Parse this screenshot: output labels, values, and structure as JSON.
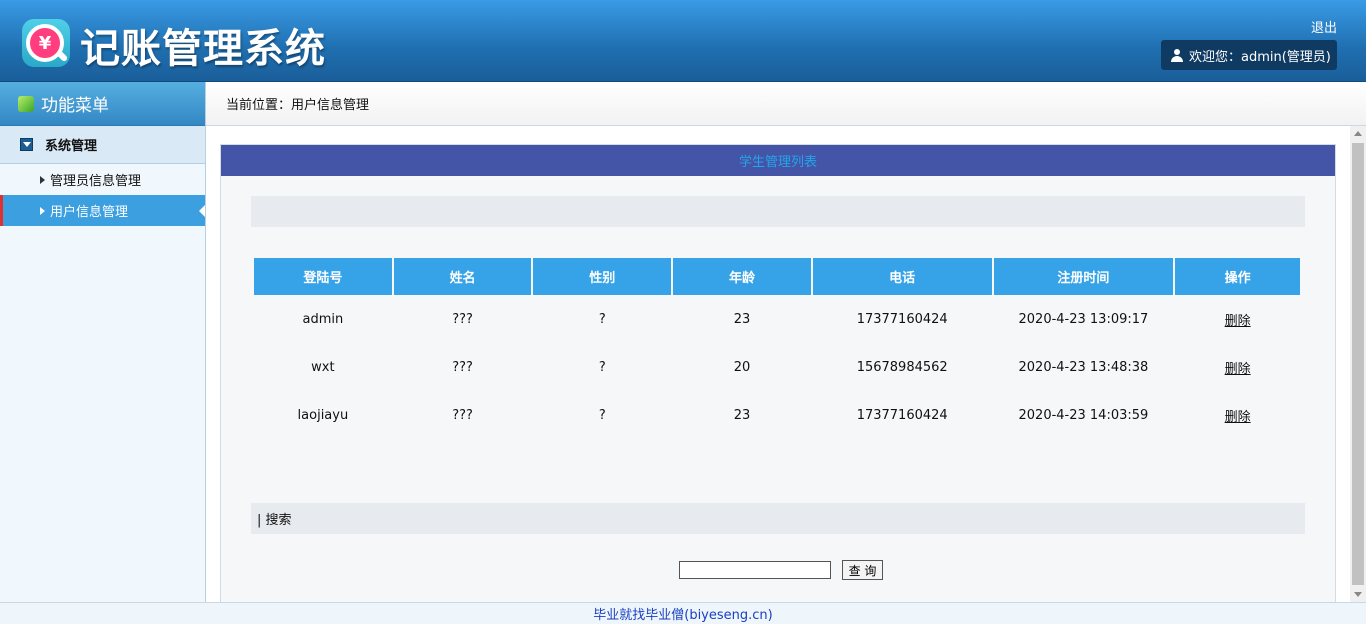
{
  "header": {
    "title": "记账管理系统",
    "logo_symbol": "¥",
    "logout_label": "退出",
    "welcome_text": "欢迎您：admin(管理员)"
  },
  "sidebar": {
    "title": "功能菜单",
    "group": {
      "label": "系统管理"
    },
    "items": [
      {
        "label": "管理员信息管理",
        "active": false
      },
      {
        "label": "用户信息管理",
        "active": true
      }
    ]
  },
  "breadcrumb": {
    "text": "当前位置：用户信息管理"
  },
  "panel": {
    "title": "学生管理列表",
    "columns": [
      "登陆号",
      "姓名",
      "性别",
      "年龄",
      "电话",
      "注册时间",
      "操作"
    ],
    "rows": [
      {
        "login": "admin",
        "name": "???",
        "gender": "?",
        "age": "23",
        "phone": "17377160424",
        "registered": "2020-4-23 13:09:17",
        "action": "删除"
      },
      {
        "login": "wxt",
        "name": "???",
        "gender": "?",
        "age": "20",
        "phone": "15678984562",
        "registered": "2020-4-23 13:48:38",
        "action": "删除"
      },
      {
        "login": "laojiayu",
        "name": "???",
        "gender": "?",
        "age": "23",
        "phone": "17377160424",
        "registered": "2020-4-23 14:03:59",
        "action": "删除"
      }
    ],
    "search_section_label": "| 搜索",
    "search_value": "",
    "search_button_label": "查 询"
  },
  "footer": {
    "text": "毕业就找毕业僧(biyeseng.cn)"
  },
  "colors": {
    "header_blue": "#1f6fb0",
    "table_header": "#36a3e8",
    "panel_title_bg": "#4455a8",
    "active_item": "#3b9fe0"
  }
}
